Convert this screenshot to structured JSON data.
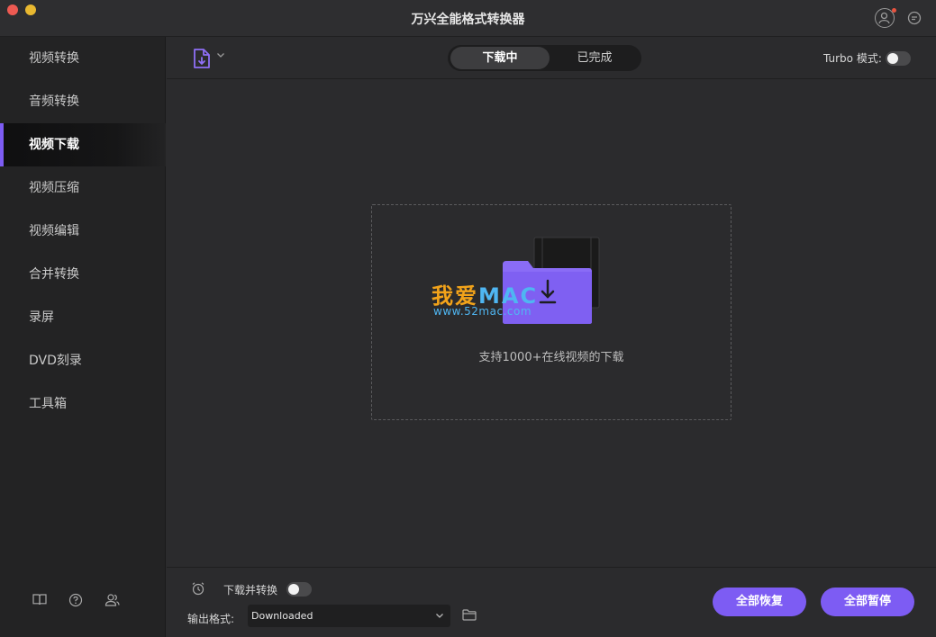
{
  "window": {
    "title": "万兴全能格式转换器"
  },
  "sidebar": {
    "items": [
      {
        "label": "视频转换"
      },
      {
        "label": "音频转换"
      },
      {
        "label": "视频下载",
        "active": true
      },
      {
        "label": "视频压缩"
      },
      {
        "label": "视频编辑"
      },
      {
        "label": "合并转换"
      },
      {
        "label": "录屏"
      },
      {
        "label": "DVD刻录"
      },
      {
        "label": "工具箱"
      }
    ],
    "footer_icons": [
      "book-icon",
      "help-icon",
      "users-icon"
    ]
  },
  "toolbar": {
    "tabs": [
      {
        "label": "下载中",
        "selected": true
      },
      {
        "label": "已完成",
        "selected": false
      }
    ],
    "turbo_label": "Turbo 模式:",
    "turbo_on": false
  },
  "drop_area": {
    "text": "支持1000+在线视频的下载"
  },
  "watermark": {
    "logo_cn": "我爱",
    "logo_mac": "MAC",
    "url": "www.52mac.com"
  },
  "bottom": {
    "download_convert_label": "下载并转换",
    "download_convert_on": false,
    "output_format_label": "输出格式:",
    "output_format_value": "Downloaded",
    "resume_all": "全部恢复",
    "pause_all": "全部暂停"
  },
  "colors": {
    "accent": "#7d5cf3",
    "background": "#2b2b2d",
    "sidebar": "#232324"
  }
}
